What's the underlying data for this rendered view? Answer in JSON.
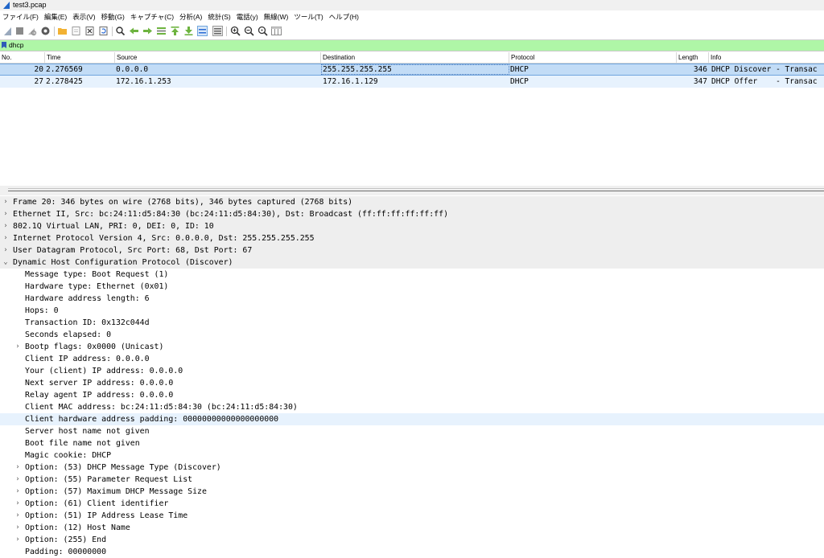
{
  "window": {
    "title": "test3.pcap"
  },
  "menu": [
    "ファイル(F)",
    "編集(E)",
    "表示(V)",
    "移動(G)",
    "キャプチャ(C)",
    "分析(A)",
    "統計(S)",
    "電話(y)",
    "無線(W)",
    "ツール(T)",
    "ヘルプ(H)"
  ],
  "filter": {
    "value": "dhcp",
    "bg_color": "#aff6a7"
  },
  "packet_list": {
    "columns": [
      "No.",
      "Time",
      "Source",
      "Destination",
      "Protocol",
      "Length",
      "Info"
    ],
    "rows": [
      {
        "no": "20",
        "time": "2.276569",
        "source": "0.0.0.0",
        "destination": "255.255.255.255",
        "protocol": "DHCP",
        "length": "346",
        "info": "DHCP Discover - Transac"
      },
      {
        "no": "27",
        "time": "2.278425",
        "source": "172.16.1.253",
        "destination": "172.16.1.129",
        "protocol": "DHCP",
        "length": "347",
        "info": "DHCP Offer    - Transac"
      }
    ]
  },
  "details": {
    "frame": "Frame 20: 346 bytes on wire (2768 bits), 346 bytes captured (2768 bits)",
    "ethernet": "Ethernet II, Src: bc:24:11:d5:84:30 (bc:24:11:d5:84:30), Dst: Broadcast (ff:ff:ff:ff:ff:ff)",
    "vlan": "802.1Q Virtual LAN, PRI: 0, DEI: 0, ID: 10",
    "ip": "Internet Protocol Version 4, Src: 0.0.0.0, Dst: 255.255.255.255",
    "udp": "User Datagram Protocol, Src Port: 68, Dst Port: 67",
    "dhcp": "Dynamic Host Configuration Protocol (Discover)",
    "dhcp_fields": {
      "message_type": "Message type: Boot Request (1)",
      "hw_type": "Hardware type: Ethernet (0x01)",
      "hw_len": "Hardware address length: 6",
      "hops": "Hops: 0",
      "xid": "Transaction ID: 0x132c044d",
      "secs": "Seconds elapsed: 0",
      "flags": "Bootp flags: 0x0000 (Unicast)",
      "ciaddr": "Client IP address: 0.0.0.0",
      "yiaddr": "Your (client) IP address: 0.0.0.0",
      "siaddr": "Next server IP address: 0.0.0.0",
      "giaddr": "Relay agent IP address: 0.0.0.0",
      "chaddr": "Client MAC address: bc:24:11:d5:84:30 (bc:24:11:d5:84:30)",
      "padding_hw": "Client hardware address padding: 00000000000000000000",
      "sname": "Server host name not given",
      "file": "Boot file name not given",
      "cookie": "Magic cookie: DHCP",
      "opt53": "Option: (53) DHCP Message Type (Discover)",
      "opt55": "Option: (55) Parameter Request List",
      "opt57": "Option: (57) Maximum DHCP Message Size",
      "opt61": "Option: (61) Client identifier",
      "opt51": "Option: (51) IP Address Lease Time",
      "opt12": "Option: (12) Host Name",
      "opt255": "Option: (255) End",
      "padding": "Padding: 00000000"
    }
  }
}
